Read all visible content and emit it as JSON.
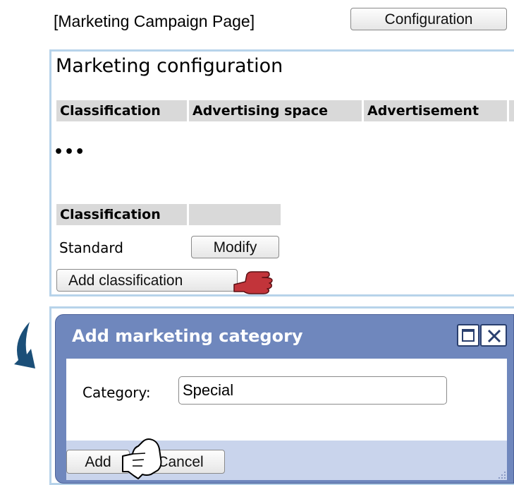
{
  "header": {
    "page_label": "[Marketing Campaign Page]",
    "config_button": "Configuration"
  },
  "config_panel": {
    "title": "Marketing configuration",
    "columns": [
      "Classification",
      "Advertising space",
      "Advertisement"
    ],
    "ellipsis": "•••",
    "class_table": {
      "header": "Classification",
      "rows": [
        {
          "name": "Standard",
          "action": "Modify"
        }
      ]
    },
    "add_button": "Add classification"
  },
  "dialog": {
    "title": "Add marketing category",
    "category_label": "Category:",
    "category_value": "Special",
    "add_button": "Add",
    "cancel_button": "Cancel"
  },
  "colors": {
    "panel_border": "#b7d3ea",
    "dialog_title_bg": "#6f87bd",
    "dialog_footer_bg": "#c9d4ec",
    "arrow": "#1b4f78",
    "hand_red": "#c2343a"
  }
}
